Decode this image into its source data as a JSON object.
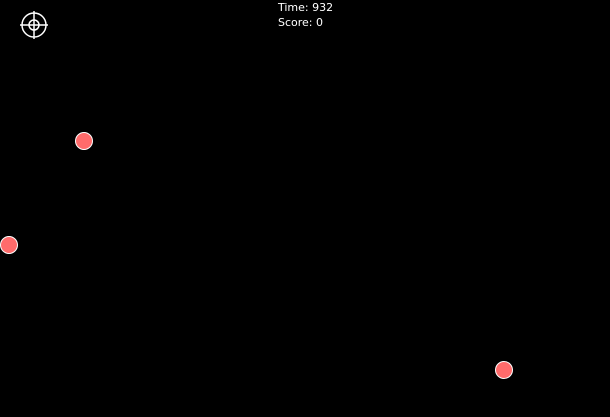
{
  "hud": {
    "time_text": "Time: 932",
    "score_text": "Score: 0"
  },
  "colors": {
    "background": "#000000",
    "target_fill": "#ff6b6b",
    "target_outline": "#ffffff",
    "hud_text": "#ffffff",
    "crosshair": "#ffffff"
  },
  "icons": {
    "cursor": "crosshair-icon",
    "target": "target-ball"
  },
  "targets": [
    {
      "id": 1
    },
    {
      "id": 2
    },
    {
      "id": 3
    }
  ]
}
